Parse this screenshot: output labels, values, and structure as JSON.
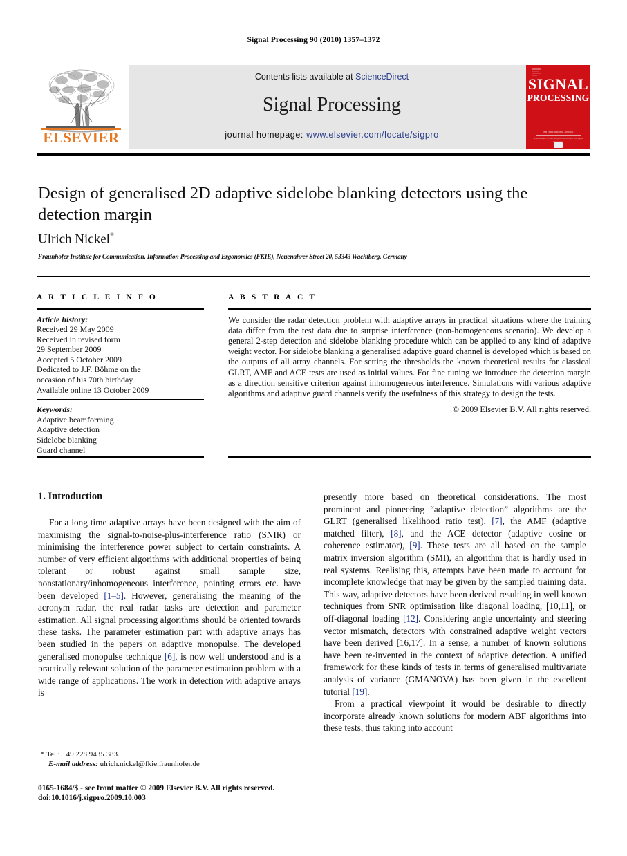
{
  "running_head": "Signal Processing 90 (2010) 1357–1372",
  "masthead": {
    "contents_prefix": "Contents lists available at ",
    "contents_link": "ScienceDirect",
    "journal_title": "Signal Processing",
    "homepage_prefix": "journal homepage: ",
    "homepage_link": "www.elsevier.com/locate/sigpro",
    "publisher_wordmark": "ELSEVIER",
    "cover": {
      "line1": "SIGNAL",
      "line2": "PROCESSING",
      "sub": "An International Journal",
      "sub2": "A publication of the European Association for Signal Processing"
    },
    "accent_orange": "#E87722",
    "cover_red": "#cf1016",
    "band_grey": "#e6e6e6",
    "link_blue": "#2b3f8c"
  },
  "article": {
    "title": "Design of generalised 2D adaptive sidelobe blanking detectors using the detection margin",
    "author": "Ulrich Nickel",
    "author_marker": "*",
    "affiliation": "Fraunhofer Institute for Communication, Information Processing and Ergonomics (FKIE), Neuenahrer Street 20, 53343 Wachtberg, Germany"
  },
  "info": {
    "heading": "A R T I C L E   I N F O",
    "history_label": "Article history:",
    "history": [
      "Received 29 May 2009",
      "Received in revised form",
      "29 September 2009",
      "Accepted 5 October 2009",
      "Dedicated to J.F. Böhme on the",
      "occasion of his 70th birthday",
      "Available online 13 October 2009"
    ],
    "keywords_label": "Keywords:",
    "keywords": [
      "Adaptive beamforming",
      "Adaptive detection",
      "Sidelobe blanking",
      "Guard channel"
    ]
  },
  "abstract": {
    "heading": "A B S T R A C T",
    "text": "We consider the radar detection problem with adaptive arrays in practical situations where the training data differ from the test data due to surprise interference (non-homogeneous scenario). We develop a general 2-step detection and sidelobe blanking procedure which can be applied to any kind of adaptive weight vector. For sidelobe blanking a generalised adaptive guard channel is developed which is based on the outputs of all array channels. For setting the thresholds the known theoretical results for classical GLRT, AMF and ACE tests are used as initial values. For fine tuning we introduce the detection margin as a direction sensitive criterion against inhomogeneous interference. Simulations with various adaptive algorithms and adaptive guard channels verify the usefulness of this strategy to design the tests.",
    "copyright": "© 2009 Elsevier B.V. All rights reserved."
  },
  "body": {
    "section_heading": "1.  Introduction",
    "left_para_1_a": "For a long time adaptive arrays have been designed with the aim of maximising the signal-to-noise-plus-interference ratio (SNIR) or minimising the interference power subject to certain constraints. A number of very efficient algorithms with additional properties of being tolerant or robust against small sample size, nonstationary/inhomogeneous interference, pointing errors etc. have been developed ",
    "left_ref_1": "[1–5]",
    "left_para_1_b": ". However, generalising the meaning of the acronym radar, the real radar tasks are detection and parameter estimation. All signal processing algorithms should be oriented towards these tasks. The parameter estimation part with adaptive arrays has been studied in the papers on adaptive monopulse. The developed generalised monopulse technique ",
    "left_ref_2": "[6]",
    "left_para_1_c": ", is now well understood and is a practically relevant solution of the parameter estimation problem with a wide range of applications. The work in detection with adaptive arrays is",
    "right_para_1_a": "presently more based on theoretical considerations. The most prominent and pioneering “adaptive detection” algorithms are the GLRT (generalised likelihood ratio test), ",
    "right_ref_1": "[7]",
    "right_para_1_b": ", the AMF (adaptive matched filter), ",
    "right_ref_2": "[8]",
    "right_para_1_c": ", and the ACE detector (adaptive cosine or coherence estimator), ",
    "right_ref_3": "[9]",
    "right_para_1_d": ". These tests are all based on the sample matrix inversion algorithm (SMI), an algorithm that is hardly used in real systems. Realising this, attempts have been made to account for incomplete knowledge that may be given by the sampled training data. This way, adaptive detectors have been derived resulting in well known techniques from SNR optimisation like diagonal loading, [10,11], or off-diagonal loading ",
    "right_ref_4": "[12]",
    "right_para_1_e": ". Considering angle uncertainty and steering vector mismatch, detectors with constrained adaptive weight vectors have been derived [16,17]. In a sense, a number of known solutions have been re-invented in the context of adaptive detection. A unified framework for these kinds of tests in terms of generalised multivariate analysis of variance (GMANOVA) has been given in the excellent tutorial ",
    "right_ref_5": "[19]",
    "right_para_1_f": ".",
    "right_para_2": "From a practical viewpoint it would be desirable to directly incorporate already known solutions for modern ABF algorithms into these tests, thus taking into account"
  },
  "footer": {
    "tel_marker": "*",
    "tel": " Tel.: +49 228 9435 383.",
    "email_label": "E-mail address:",
    "email": " ulrich.nickel@fkie.fraunhofer.de",
    "issn_line": "0165-1684/$ - see front matter © 2009 Elsevier B.V. All rights reserved.",
    "doi_line": "doi:10.1016/j.sigpro.2009.10.003"
  }
}
